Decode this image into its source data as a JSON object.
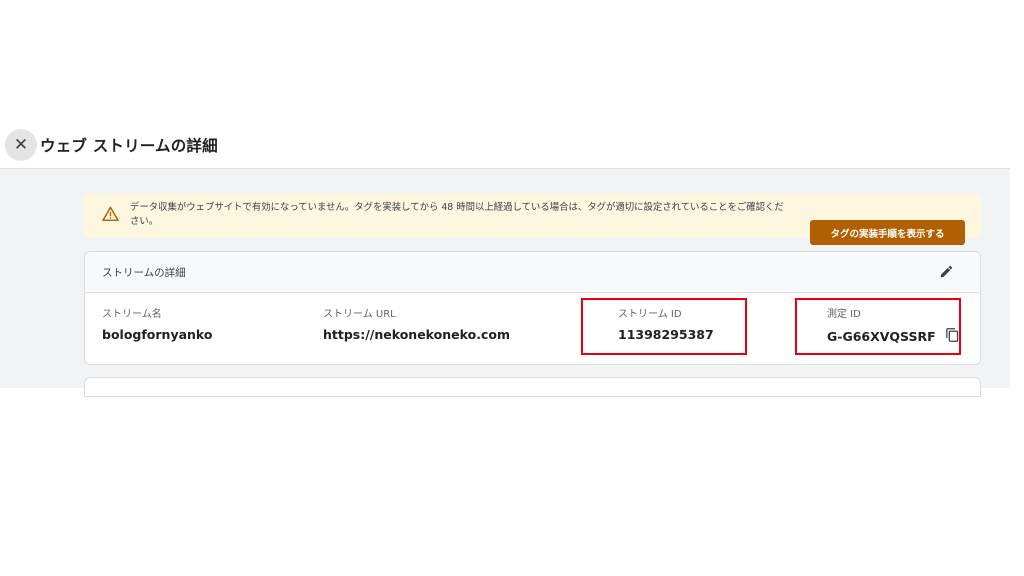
{
  "header": {
    "title": "ウェブ ストリームの詳細",
    "close_icon": "close-icon"
  },
  "alert": {
    "icon": "warning-icon",
    "text": "データ収集がウェブサイトで有効になっていません。タグを実装してから 48 時間以上経過している場合は、タグが適切に設定されていることをご確認ください。",
    "button_label": "タグの実装手順を表示する",
    "accent_color": "#b06000",
    "background_color": "#fef7e0"
  },
  "stream_details": {
    "title": "ストリームの詳細",
    "edit_icon": "pencil-icon",
    "fields": {
      "name": {
        "label": "ストリーム名",
        "value": "bologfornyanko"
      },
      "url": {
        "label": "ストリーム URL",
        "value": "https://nekonekoneko.com"
      },
      "stream_id": {
        "label": "ストリーム ID",
        "value": "11398295387"
      },
      "measurement_id": {
        "label": "測定 ID",
        "value": "G-G66XVQSSRF",
        "copy_icon": "copy-icon"
      }
    }
  },
  "highlight_color": "#e60012"
}
